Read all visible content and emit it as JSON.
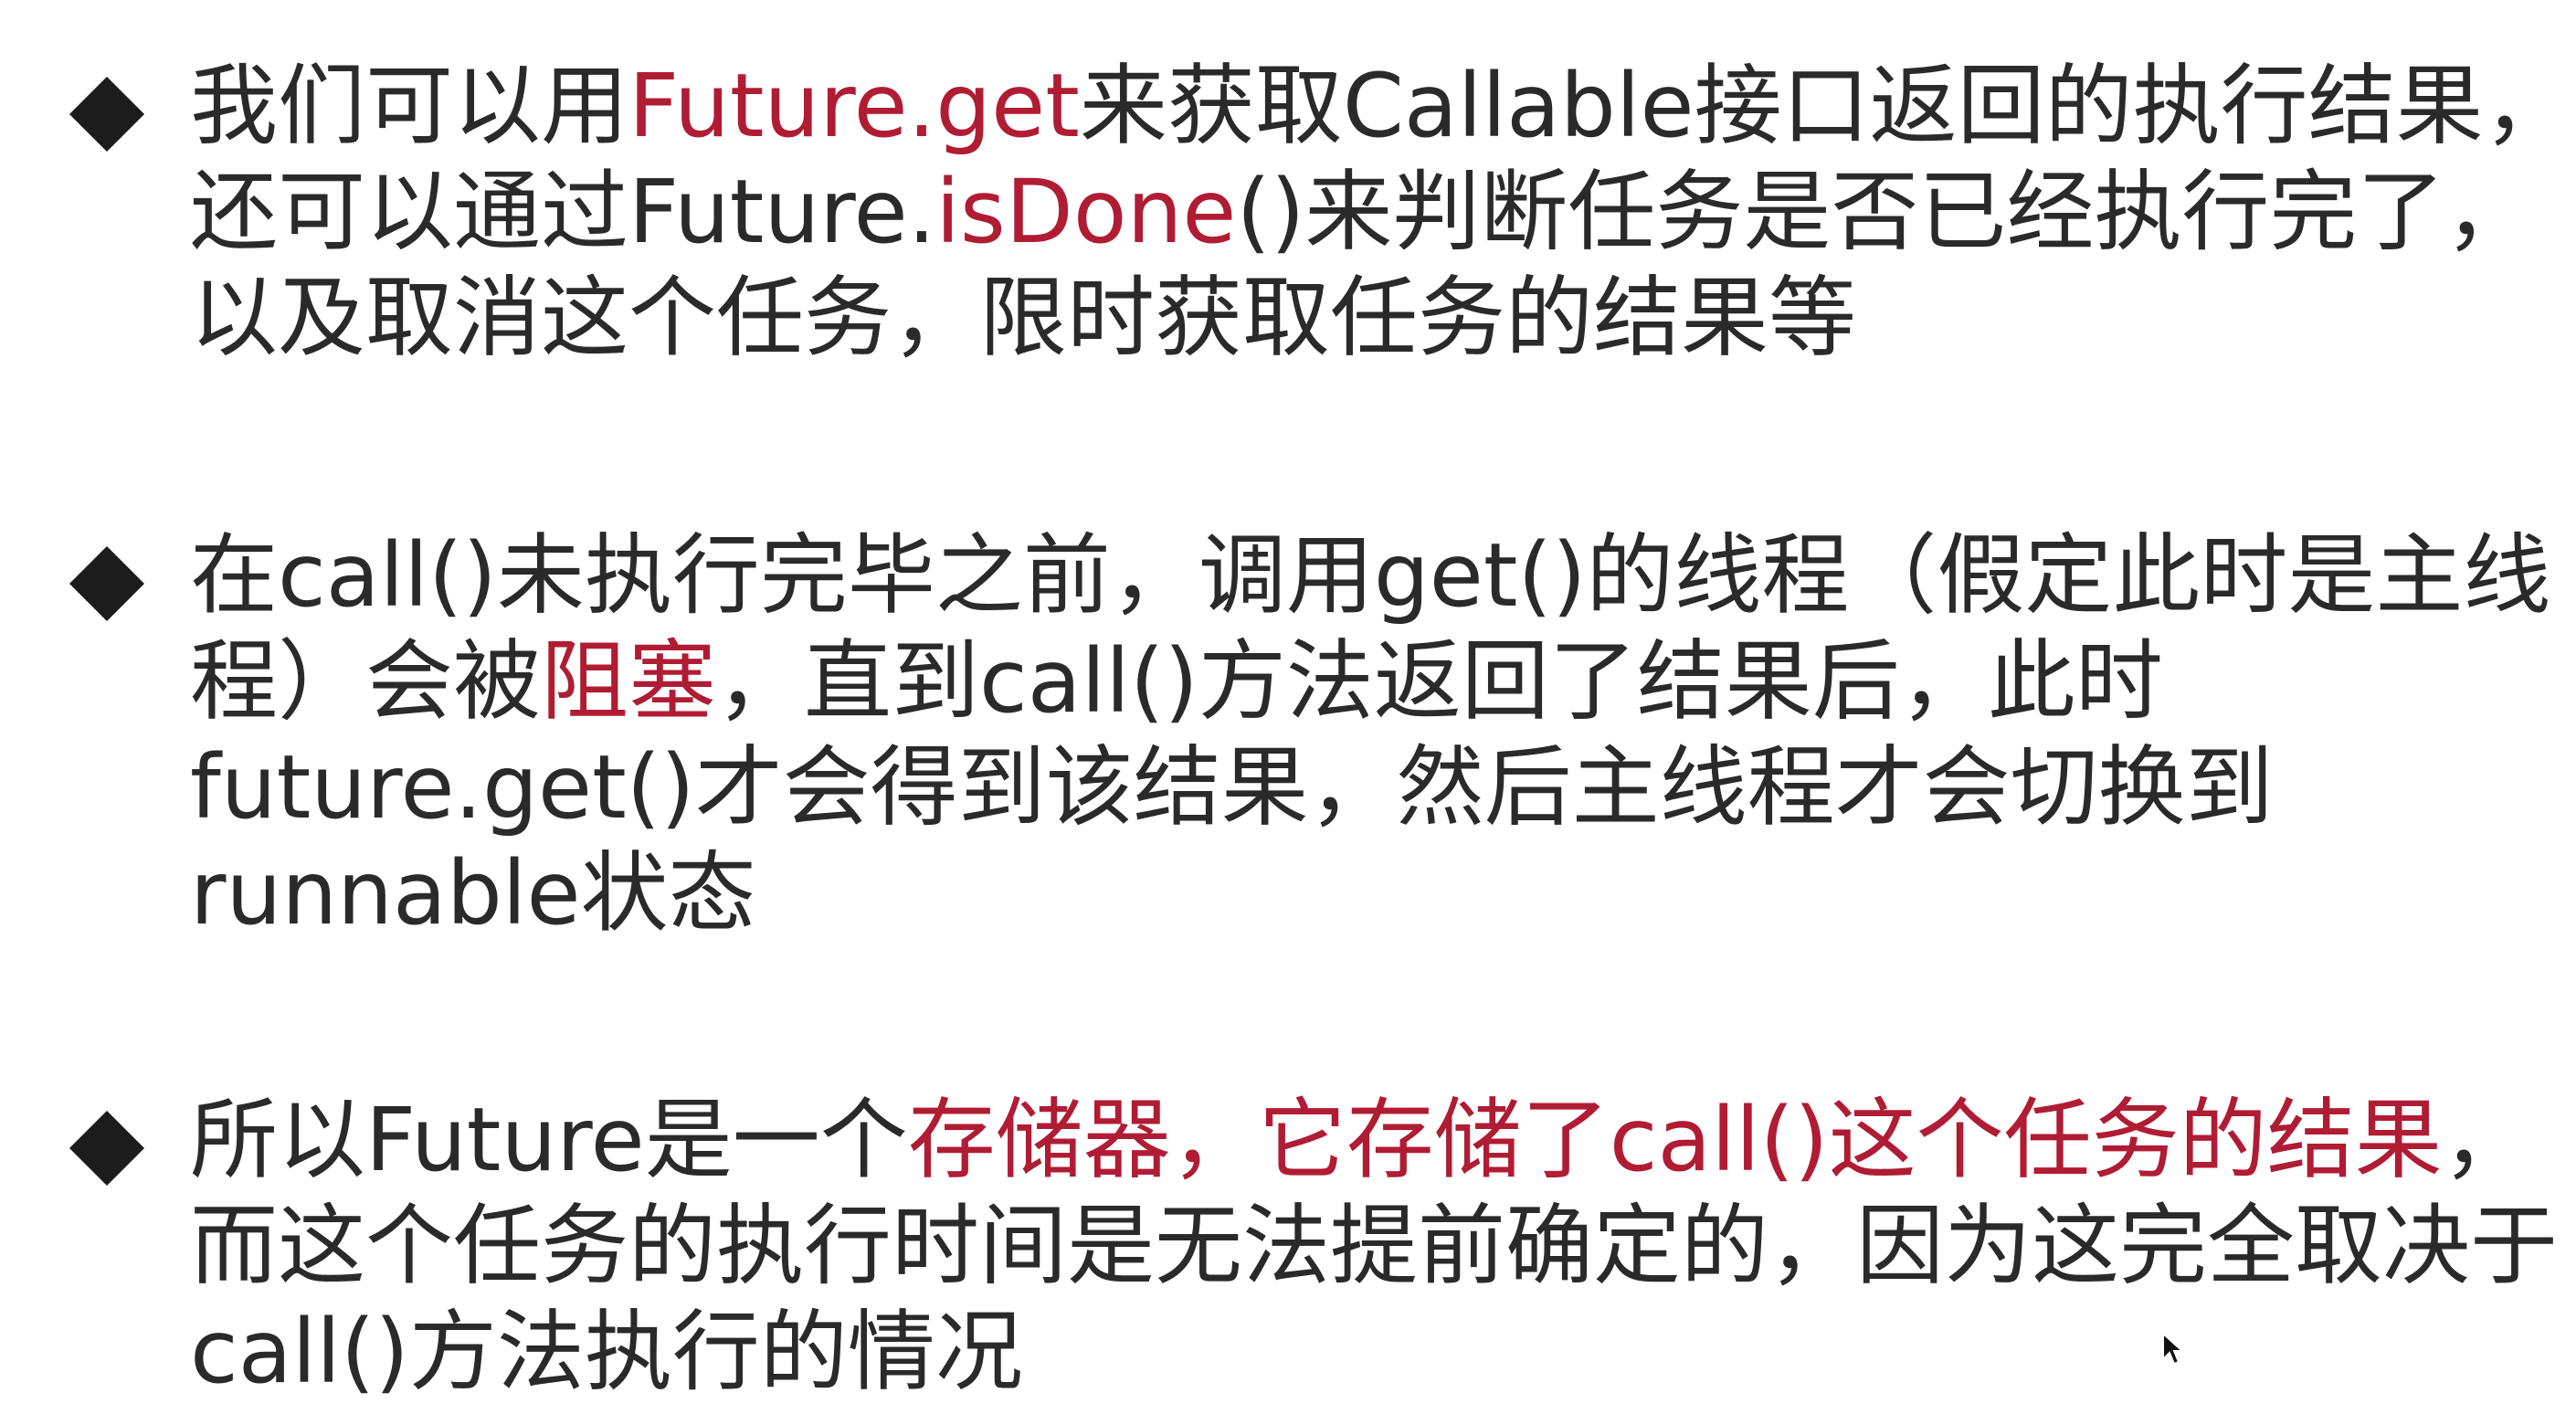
{
  "colors": {
    "text": "#2a2a2a",
    "highlight": "#b01c34",
    "bullet": "#1c1c1c",
    "background": "#ffffff"
  },
  "bullets": [
    {
      "icon": "diamond-bullet-icon",
      "lines": [
        [
          "我们可以用",
          "Future.get",
          "来获取Callable接口返回的执行结果，"
        ],
        [
          "还可以通过Future.",
          "isDone",
          "()来判断任务是否已经执行完了，"
        ],
        [
          "以及取消这个任务，限时获取任务的结果等"
        ]
      ]
    },
    {
      "icon": "diamond-bullet-icon",
      "lines": [
        [
          "在call()未执行完毕之前，调用get()的线程（假定此时是主线"
        ],
        [
          "程）会被",
          "阻塞",
          "，直到call()方法返回了结果后，此时"
        ],
        [
          "future.get()才会得到该结果，然后主线程才会切换到"
        ],
        [
          "runnable状态"
        ]
      ]
    },
    {
      "icon": "diamond-bullet-icon",
      "lines": [
        [
          "所以Future是一个",
          "存储器，它存储了call()这个任务的结果",
          "，"
        ],
        [
          "而这个任务的执行时间是无法提前确定的，因为这完全取决于"
        ],
        [
          "call()方法执行的情况"
        ]
      ]
    }
  ]
}
